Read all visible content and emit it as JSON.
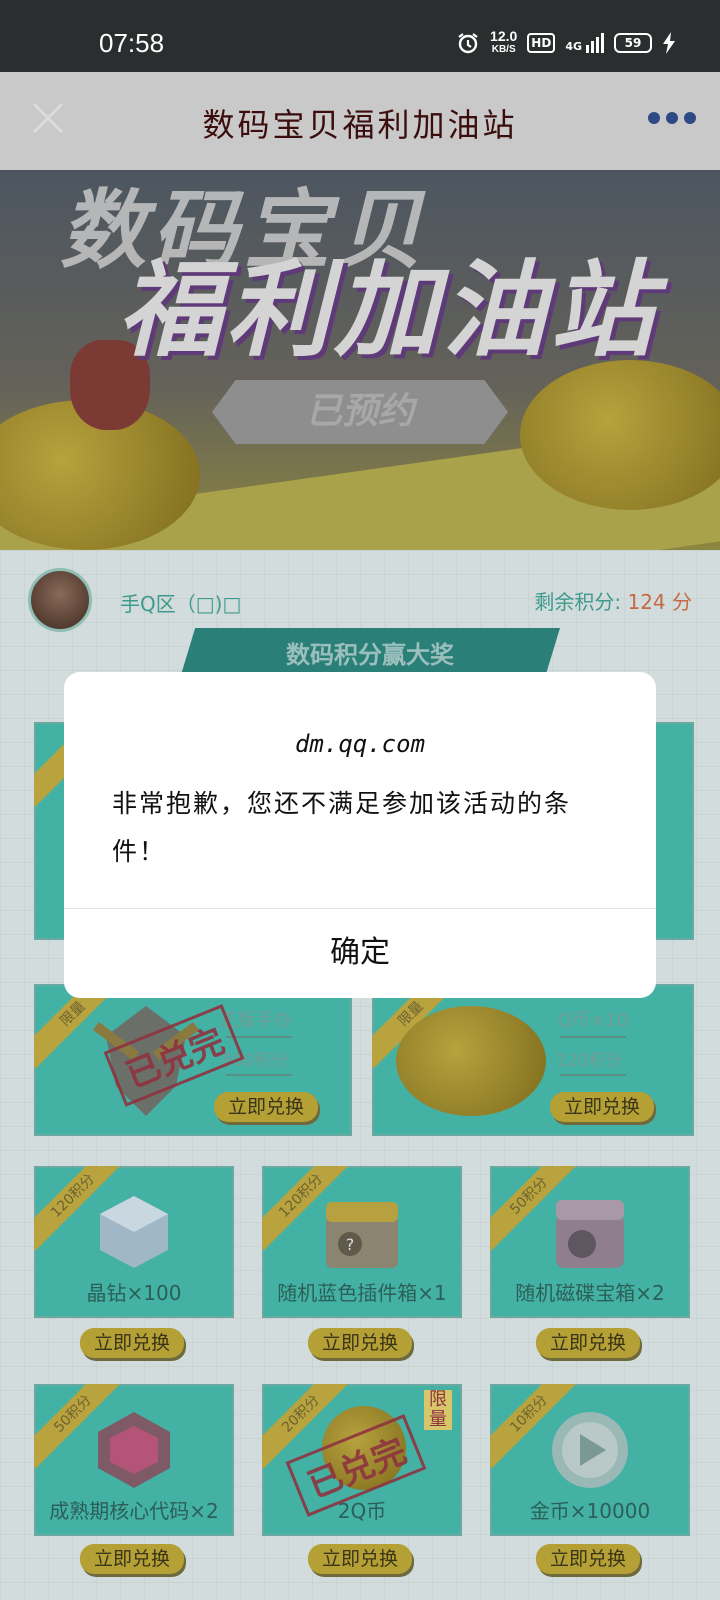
{
  "status_bar": {
    "time": "07:58",
    "net_speed_value": "12.0",
    "net_speed_unit": "KB/S",
    "hd": "HD",
    "network": "4G",
    "battery": "59"
  },
  "nav": {
    "title": "数码宝贝福利加油站"
  },
  "banner": {
    "title_line1": "数码宝贝",
    "title_line2": "福利加油站",
    "reserve_label": "已预约"
  },
  "user": {
    "name": "手Q区（□)□",
    "points_label": "剩余积分:",
    "points_value": "124 分"
  },
  "section_title": "数码积分赢大奖",
  "featured": [
    {
      "tag": "限量",
      "name": "正版手办",
      "points": "800积分",
      "button": "立即兑换",
      "stamp": "已兑完"
    },
    {
      "tag": "限量",
      "name": "Q币×10",
      "points": "120积分",
      "button": "立即兑换"
    }
  ],
  "items_row1": [
    {
      "tag": "120积分",
      "label": "晶钻×100",
      "button": "立即兑换"
    },
    {
      "tag": "120积分",
      "label": "随机蓝色插件箱×1",
      "button": "立即兑换"
    },
    {
      "tag": "50积分",
      "label": "随机磁碟宝箱×2",
      "button": "立即兑换"
    }
  ],
  "items_row2": [
    {
      "tag": "50积分",
      "label": "成熟期核心代码×2",
      "button": "立即兑换"
    },
    {
      "tag": "20积分",
      "label": "2Q币",
      "button": "立即兑换",
      "badge": "限量",
      "stamp": "已兑完"
    },
    {
      "tag": "10积分",
      "label": "金币×10000",
      "button": "立即兑换"
    }
  ],
  "dialog": {
    "domain": "dm.qq.com",
    "message": "非常抱歉，您还不满足参加该活动的条件！",
    "ok": "确定"
  },
  "colors": {
    "accent_teal": "#43b1a4",
    "gold": "#b4a035",
    "points_value": "#c46a44"
  }
}
